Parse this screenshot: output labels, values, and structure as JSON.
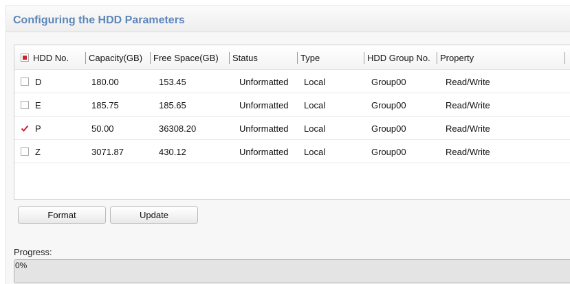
{
  "title": "Configuring the HDD Parameters",
  "table": {
    "headers": [
      "HDD No.",
      "Capacity(GB)",
      "Free Space(GB)",
      "Status",
      "Type",
      "HDD Group No.",
      "Property"
    ],
    "select_all_checked": true,
    "rows": [
      {
        "checked": false,
        "hdd_no": "D",
        "capacity": "180.00",
        "free_space": "153.45",
        "status": "Unformatted",
        "type": "Local",
        "group": "Group00",
        "property": "Read/Write"
      },
      {
        "checked": false,
        "hdd_no": "E",
        "capacity": "185.75",
        "free_space": "185.65",
        "status": "Unformatted",
        "type": "Local",
        "group": "Group00",
        "property": "Read/Write"
      },
      {
        "checked": true,
        "hdd_no": "P",
        "capacity": "50.00",
        "free_space": "36308.20",
        "status": "Unformatted",
        "type": "Local",
        "group": "Group00",
        "property": "Read/Write"
      },
      {
        "checked": false,
        "hdd_no": "Z",
        "capacity": "3071.87",
        "free_space": "430.12",
        "status": "Unformatted",
        "type": "Local",
        "group": "Group00",
        "property": "Read/Write"
      }
    ]
  },
  "buttons": {
    "format": "Format",
    "update": "Update"
  },
  "progress": {
    "label": "Progress:",
    "text": "0%",
    "value": 0
  },
  "colors": {
    "title": "#5d86b9",
    "check_red": "#d0202e"
  }
}
